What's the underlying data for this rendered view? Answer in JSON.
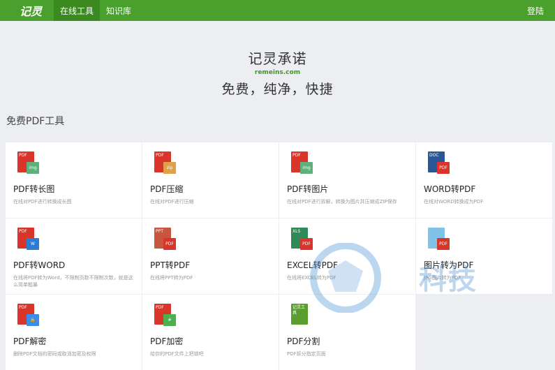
{
  "header": {
    "logo": "记灵",
    "nav": [
      "在线工具",
      "知识库"
    ],
    "login": "登陆"
  },
  "hero": {
    "title": "记灵承诺",
    "domain": "remeins.com",
    "subtitle": "免费，纯净，快捷"
  },
  "section_title": "免费PDF工具",
  "tools": [
    {
      "title": "PDF转长图",
      "desc": "在线对PDF进行转换成长图",
      "icon": "pdf-to-image-icon",
      "doc_label": "PDF",
      "doc_color": "#d9352a",
      "badge": "img",
      "badge_color": "#5fb07a"
    },
    {
      "title": "PDF压缩",
      "desc": "在线对PDF进行压缩",
      "icon": "pdf-compress-icon",
      "doc_label": "PDF",
      "doc_color": "#d9352a",
      "badge": "zip",
      "badge_color": "#e0a04a"
    },
    {
      "title": "PDF转图片",
      "desc": "在线对PDF进行拆解，转换为图片并压缩成ZIP保存",
      "icon": "pdf-to-picture-icon",
      "doc_label": "PDF",
      "doc_color": "#d9352a",
      "badge": "img",
      "badge_color": "#5fb07a"
    },
    {
      "title": "WORD转PDF",
      "desc": "在线对WORD转换成为PDF",
      "icon": "word-to-pdf-icon",
      "doc_label": "DOC",
      "doc_color": "#2b5797",
      "badge": "PDF",
      "badge_color": "#d9352a"
    },
    {
      "title": "PDF转WORD",
      "desc": "在线将PDF转为Word，不限制页数不限制次数，就是这么简单粗暴",
      "icon": "pdf-to-word-icon",
      "doc_label": "PDF",
      "doc_color": "#d9352a",
      "badge": "W",
      "badge_color": "#2b7cd3"
    },
    {
      "title": "PPT转PDF",
      "desc": "在线将PPT转为PDF",
      "icon": "ppt-to-pdf-icon",
      "doc_label": "PPT",
      "doc_color": "#c8553d",
      "badge": "PDF",
      "badge_color": "#d9352a"
    },
    {
      "title": "EXCEL转PDF",
      "desc": "在线将EXCEL转为PDF",
      "icon": "excel-to-pdf-icon",
      "doc_label": "XLS",
      "doc_color": "#2e8b57",
      "badge": "PDF",
      "badge_color": "#d9352a"
    },
    {
      "title": "图片转为PDF",
      "desc": "JPG图片转为PDF",
      "icon": "image-to-pdf-icon",
      "doc_label": "",
      "doc_color": "#7fc4e8",
      "badge": "PDF",
      "badge_color": "#d9352a"
    },
    {
      "title": "PDF解密",
      "desc": "删除PDF文档的密码或取消加密及权限",
      "icon": "pdf-decrypt-icon",
      "doc_label": "PDF",
      "doc_color": "#d9352a",
      "badge": "🔓",
      "badge_color": "#3a8ee6"
    },
    {
      "title": "PDF加密",
      "desc": "给你的PDF文件上把锁吧",
      "icon": "pdf-encrypt-icon",
      "doc_label": "PDF",
      "doc_color": "#d9352a",
      "badge": "#",
      "badge_color": "#4caf50"
    },
    {
      "title": "PDF分割",
      "desc": "PDF拆分指定页面",
      "icon": "pdf-split-icon",
      "doc_label": "记灵工具",
      "doc_color": "#5a9e2f",
      "badge": "",
      "badge_color": ""
    }
  ],
  "watermark": "科技"
}
